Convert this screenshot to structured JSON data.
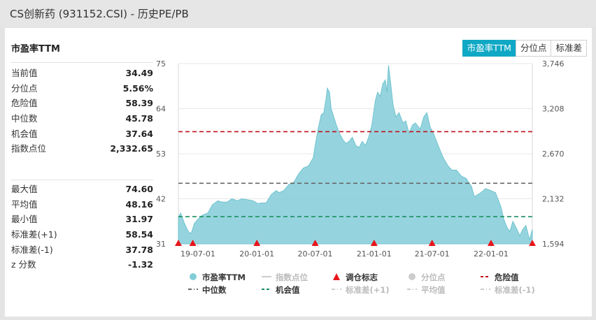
{
  "header": {
    "title": "CS创新药 (931152.CSI) - 历史PE/PB"
  },
  "card": {
    "title": "市盈率TTM"
  },
  "tabs": [
    {
      "label": "市盈率TTM",
      "active": true
    },
    {
      "label": "分位点",
      "active": false
    },
    {
      "label": "标准差",
      "active": false
    }
  ],
  "stats_top": [
    {
      "label": "当前值",
      "value": "34.49"
    },
    {
      "label": "分位点",
      "value": "5.56%"
    },
    {
      "label": "危险值",
      "value": "58.39"
    },
    {
      "label": "中位数",
      "value": "45.78"
    },
    {
      "label": "机会值",
      "value": "37.64"
    },
    {
      "label": "指数点位",
      "value": "2,332.65"
    }
  ],
  "stats_bottom": [
    {
      "label": "最大值",
      "value": "74.60"
    },
    {
      "label": "平均值",
      "value": "48.16"
    },
    {
      "label": "最小值",
      "value": "31.97"
    },
    {
      "label": "标准差(+1)",
      "value": "58.54"
    },
    {
      "label": "标准差(-1)",
      "value": "37.78"
    },
    {
      "label": "z 分数",
      "value": "-1.32"
    }
  ],
  "legend": [
    [
      {
        "label": "市盈率TTM",
        "marker": "dot",
        "color": "#82cdd8",
        "enabled": true
      },
      {
        "label": "指数点位",
        "marker": "line",
        "color": "#cccccc",
        "enabled": false
      },
      {
        "label": "调仓标志",
        "marker": "triangle",
        "color": "#e8161b",
        "enabled": true
      },
      {
        "label": "分位点",
        "marker": "dot",
        "color": "#cccccc",
        "enabled": false
      },
      {
        "label": "危险值",
        "marker": "dash",
        "color": "#c0101a",
        "enabled": true
      }
    ],
    [
      {
        "label": "中位数",
        "marker": "dashdot",
        "color": "#666666",
        "enabled": true
      },
      {
        "label": "机会值",
        "marker": "dash",
        "color": "#1c8f62",
        "enabled": true
      },
      {
        "label": "标准差(+1)",
        "marker": "dashdot",
        "color": "#cccccc",
        "enabled": false
      },
      {
        "label": "平均值",
        "marker": "dashdot",
        "color": "#cccccc",
        "enabled": false
      },
      {
        "label": "标准差(-1)",
        "marker": "dashdot",
        "color": "#cccccc",
        "enabled": false
      }
    ]
  ],
  "chart_data": {
    "type": "area",
    "series": [
      {
        "name": "市盈率TTM",
        "color": "#82cdd8",
        "points": [
          [
            "2019-05-01",
            37.5
          ],
          [
            "2019-05-08",
            38.5
          ],
          [
            "2019-05-20",
            36
          ],
          [
            "2019-06-01",
            34
          ],
          [
            "2019-06-10",
            33.5
          ],
          [
            "2019-06-20",
            36
          ],
          [
            "2019-07-01",
            37
          ],
          [
            "2019-07-15",
            38
          ],
          [
            "2019-08-01",
            38.5
          ],
          [
            "2019-08-15",
            40.5
          ],
          [
            "2019-09-01",
            41.5
          ],
          [
            "2019-09-15",
            41.2
          ],
          [
            "2019-10-01",
            41.2
          ],
          [
            "2019-10-15",
            42
          ],
          [
            "2019-11-01",
            41.5
          ],
          [
            "2019-11-15",
            42
          ],
          [
            "2019-12-01",
            41.8
          ],
          [
            "2019-12-20",
            41.5
          ],
          [
            "2020-01-05",
            40.8
          ],
          [
            "2020-01-15",
            41
          ],
          [
            "2020-01-30",
            41
          ],
          [
            "2020-02-15",
            43
          ],
          [
            "2020-03-01",
            44
          ],
          [
            "2020-03-10",
            43.5
          ],
          [
            "2020-03-25",
            44
          ],
          [
            "2020-04-10",
            45.5
          ],
          [
            "2020-04-25",
            46
          ],
          [
            "2020-05-10",
            48
          ],
          [
            "2020-05-25",
            49.5
          ],
          [
            "2020-06-10",
            50
          ],
          [
            "2020-06-25",
            52
          ],
          [
            "2020-07-01",
            55
          ],
          [
            "2020-07-10",
            59
          ],
          [
            "2020-07-20",
            62.5
          ],
          [
            "2020-07-28",
            63
          ],
          [
            "2020-08-05",
            67
          ],
          [
            "2020-08-08",
            69
          ],
          [
            "2020-08-15",
            68
          ],
          [
            "2020-08-20",
            64
          ],
          [
            "2020-08-28",
            62
          ],
          [
            "2020-09-05",
            60
          ],
          [
            "2020-09-15",
            58
          ],
          [
            "2020-09-25",
            56.5
          ],
          [
            "2020-10-05",
            55.5
          ],
          [
            "2020-10-15",
            56
          ],
          [
            "2020-10-25",
            57
          ],
          [
            "2020-11-05",
            55
          ],
          [
            "2020-11-15",
            54.5
          ],
          [
            "2020-11-25",
            56
          ],
          [
            "2020-12-05",
            55
          ],
          [
            "2020-12-15",
            57
          ],
          [
            "2020-12-25",
            60
          ],
          [
            "2021-01-05",
            66
          ],
          [
            "2021-01-12",
            68
          ],
          [
            "2021-01-20",
            67
          ],
          [
            "2021-01-28",
            70
          ],
          [
            "2021-02-05",
            71
          ],
          [
            "2021-02-10",
            68
          ],
          [
            "2021-02-15",
            74.6
          ],
          [
            "2021-02-22",
            70
          ],
          [
            "2021-03-01",
            65
          ],
          [
            "2021-03-10",
            62
          ],
          [
            "2021-03-20",
            63
          ],
          [
            "2021-04-01",
            60.5
          ],
          [
            "2021-04-10",
            61
          ],
          [
            "2021-04-20",
            58
          ],
          [
            "2021-05-01",
            60
          ],
          [
            "2021-05-10",
            60.5
          ],
          [
            "2021-05-25",
            59
          ],
          [
            "2021-06-05",
            62
          ],
          [
            "2021-06-15",
            63
          ],
          [
            "2021-06-25",
            59.5
          ],
          [
            "2021-07-05",
            58
          ],
          [
            "2021-07-15",
            56
          ],
          [
            "2021-07-25",
            54
          ],
          [
            "2021-08-05",
            52
          ],
          [
            "2021-08-20",
            50
          ],
          [
            "2021-09-01",
            49
          ],
          [
            "2021-09-15",
            49
          ],
          [
            "2021-10-01",
            47.5
          ],
          [
            "2021-10-15",
            47
          ],
          [
            "2021-11-01",
            45
          ],
          [
            "2021-11-10",
            42.5
          ],
          [
            "2021-11-20",
            43
          ],
          [
            "2021-12-01",
            43.5
          ],
          [
            "2021-12-15",
            44.5
          ],
          [
            "2022-01-01",
            44
          ],
          [
            "2022-01-15",
            43.5
          ],
          [
            "2022-02-01",
            40
          ],
          [
            "2022-02-10",
            37
          ],
          [
            "2022-02-20",
            35
          ],
          [
            "2022-03-01",
            34
          ],
          [
            "2022-03-10",
            36.5
          ],
          [
            "2022-03-20",
            35
          ],
          [
            "2022-04-01",
            33
          ],
          [
            "2022-04-10",
            34.5
          ],
          [
            "2022-04-20",
            35.5
          ],
          [
            "2022-05-01",
            32
          ],
          [
            "2022-05-10",
            34.5
          ]
        ]
      }
    ],
    "reference_lines": [
      {
        "name": "危险值",
        "value": 58.39,
        "color": "#c0101a",
        "style": "dash"
      },
      {
        "name": "中位数",
        "value": 45.78,
        "color": "#666666",
        "style": "dash"
      },
      {
        "name": "机会值",
        "value": 37.64,
        "color": "#1c8f62",
        "style": "dash"
      }
    ],
    "rebalance_markers": [
      "2019-05-01",
      "2019-06-15",
      "2020-01-01",
      "2020-07-01",
      "2021-01-01",
      "2021-07-01",
      "2022-01-01",
      "2022-05-10"
    ],
    "x_ticks": [
      {
        "label": "19-07-01",
        "date": "2019-07-01"
      },
      {
        "label": "20-01-01",
        "date": "2020-01-01"
      },
      {
        "label": "20-07-01",
        "date": "2020-07-01"
      },
      {
        "label": "21-01-01",
        "date": "2021-01-01"
      },
      {
        "label": "21-07-01",
        "date": "2021-07-01"
      },
      {
        "label": "22-01-01",
        "date": "2022-01-01"
      }
    ],
    "x_range": [
      "2019-05-01",
      "2022-05-10"
    ],
    "y_left": {
      "ticks": [
        "75",
        "64",
        "53",
        "42",
        "31"
      ],
      "range": [
        31,
        75
      ]
    },
    "y_right": {
      "ticks": [
        "3,746",
        "3,208",
        "2,670",
        "2,132",
        "1,594"
      ],
      "range": [
        1594,
        3746
      ]
    },
    "grid": true
  }
}
